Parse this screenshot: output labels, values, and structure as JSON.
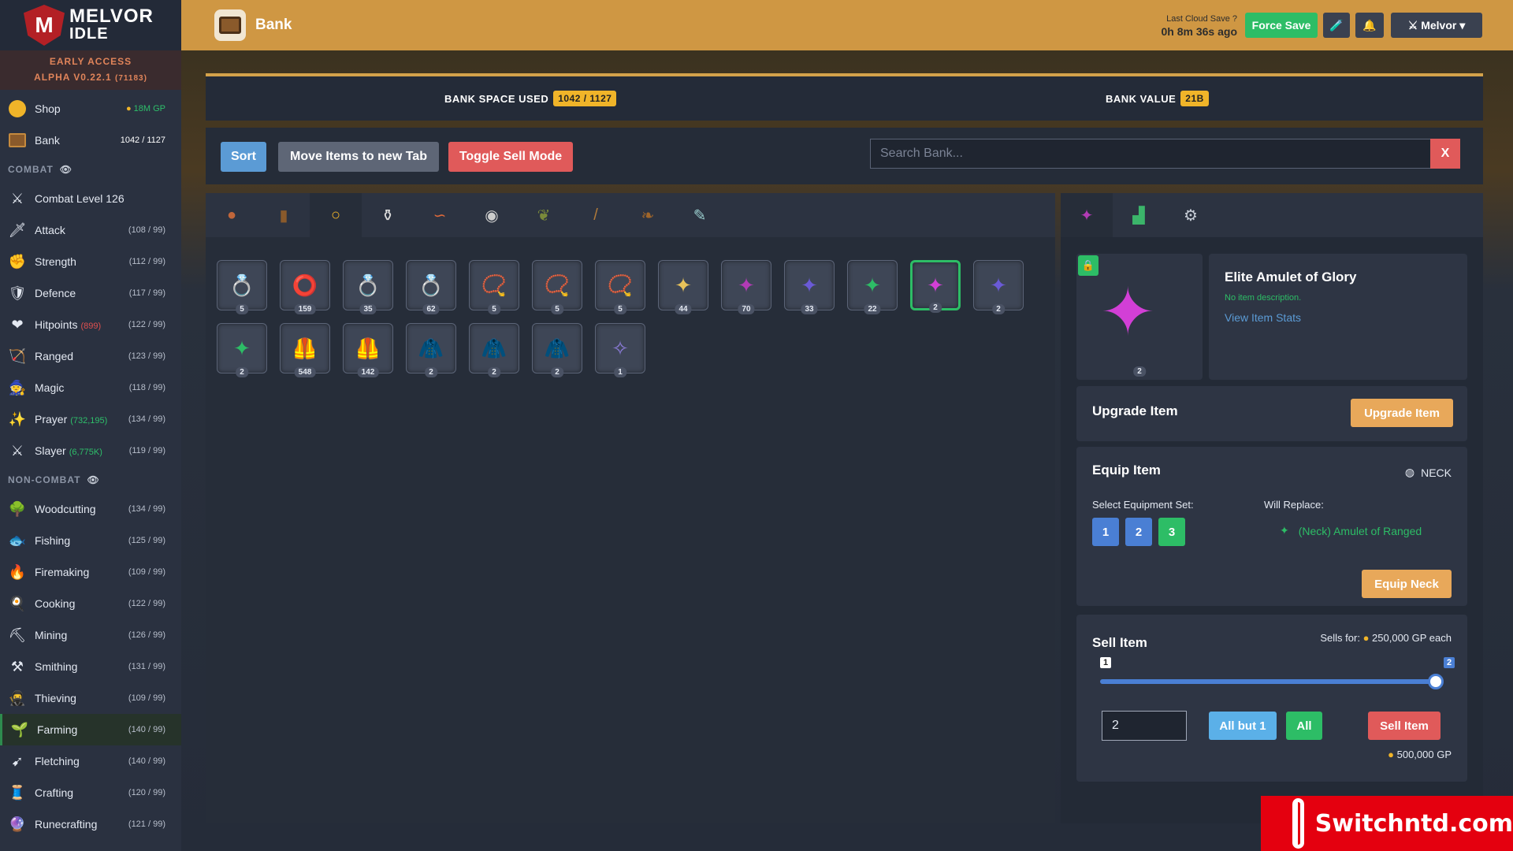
{
  "sidebar": {
    "logo_line1": "MELVOR",
    "logo_line2": "IDLE",
    "early_access": "EARLY ACCESS",
    "version": "ALPHA V0.22.1",
    "build": "(71183)",
    "shop": {
      "label": "Shop",
      "value": "18M GP"
    },
    "bank": {
      "label": "Bank",
      "value": "1042 / 1127"
    },
    "combat_header": "COMBAT",
    "combat_level": "Combat Level 126",
    "combat_skills": [
      {
        "name": "Attack",
        "sub": "",
        "lv": "(108 / 99)",
        "icon": "sword-icon",
        "glyph": "🗡"
      },
      {
        "name": "Strength",
        "sub": "",
        "lv": "(112 / 99)",
        "icon": "fist-icon",
        "glyph": "✊"
      },
      {
        "name": "Defence",
        "sub": "",
        "lv": "(117 / 99)",
        "icon": "shield-icon",
        "glyph": "🛡"
      },
      {
        "name": "Hitpoints",
        "sub": "(899)",
        "lv": "(122 / 99)",
        "icon": "heart-icon",
        "glyph": "❤"
      },
      {
        "name": "Ranged",
        "sub": "",
        "lv": "(123 / 99)",
        "icon": "bow-icon",
        "glyph": "🏹"
      },
      {
        "name": "Magic",
        "sub": "",
        "lv": "(118 / 99)",
        "icon": "wizard-hat-icon",
        "glyph": "🧙"
      },
      {
        "name": "Prayer",
        "sub": "(732,195)",
        "lv": "(134 / 99)",
        "icon": "prayer-icon",
        "glyph": "✨"
      },
      {
        "name": "Slayer",
        "sub": "(6,775K)",
        "lv": "(119 / 99)",
        "icon": "slayer-icon",
        "glyph": "⚔"
      }
    ],
    "noncombat_header": "NON-COMBAT",
    "noncombat_skills": [
      {
        "name": "Woodcutting",
        "lv": "(134 / 99)",
        "icon": "tree-icon",
        "glyph": "🌳"
      },
      {
        "name": "Fishing",
        "lv": "(125 / 99)",
        "icon": "fish-icon",
        "glyph": "🐟"
      },
      {
        "name": "Firemaking",
        "lv": "(109 / 99)",
        "icon": "fire-icon",
        "glyph": "🔥"
      },
      {
        "name": "Cooking",
        "lv": "(122 / 99)",
        "icon": "chef-hat-icon",
        "glyph": "🍳"
      },
      {
        "name": "Mining",
        "lv": "(126 / 99)",
        "icon": "pickaxe-icon",
        "glyph": "⛏"
      },
      {
        "name": "Smithing",
        "lv": "(131 / 99)",
        "icon": "anvil-icon",
        "glyph": "⚒"
      },
      {
        "name": "Thieving",
        "lv": "(109 / 99)",
        "icon": "thief-icon",
        "glyph": "🥷"
      },
      {
        "name": "Farming",
        "lv": "(140 / 99)",
        "icon": "sprout-icon",
        "glyph": "🌱"
      },
      {
        "name": "Fletching",
        "lv": "(140 / 99)",
        "icon": "arrow-icon",
        "glyph": "➹"
      },
      {
        "name": "Crafting",
        "lv": "(120 / 99)",
        "icon": "crafting-icon",
        "glyph": "🧵"
      },
      {
        "name": "Runecrafting",
        "lv": "(121 / 99)",
        "icon": "rune-icon",
        "glyph": "🔮"
      }
    ]
  },
  "header": {
    "title": "Bank",
    "cloud_label": "Last Cloud Save",
    "cloud_time": "0h 8m 36s ago",
    "force_save": "Force Save",
    "user": "Melvor"
  },
  "infobar": {
    "space_label": "BANK SPACE USED",
    "space_value": "1042 / 1127",
    "value_label": "BANK VALUE",
    "value_value": "21B"
  },
  "toolbar": {
    "sort": "Sort",
    "move": "Move Items to new Tab",
    "toggle_sell": "Toggle Sell Mode",
    "search_placeholder": "Search Bank...",
    "clear": "X"
  },
  "items": [
    {
      "count": "5",
      "glyph": "💍"
    },
    {
      "count": "159",
      "glyph": "⭕"
    },
    {
      "count": "35",
      "glyph": "💍"
    },
    {
      "count": "62",
      "glyph": "💍"
    },
    {
      "count": "5",
      "glyph": "📿"
    },
    {
      "count": "5",
      "glyph": "📿"
    },
    {
      "count": "5",
      "glyph": "📿"
    },
    {
      "count": "44",
      "glyph": "✦"
    },
    {
      "count": "70",
      "glyph": "✦"
    },
    {
      "count": "33",
      "glyph": "✦"
    },
    {
      "count": "22",
      "glyph": "✦"
    },
    {
      "count": "2",
      "glyph": "✦"
    },
    {
      "count": "2",
      "glyph": "✦"
    },
    {
      "count": "2",
      "glyph": "✦"
    },
    {
      "count": "548",
      "glyph": "🦺"
    },
    {
      "count": "142",
      "glyph": "🦺"
    },
    {
      "count": "2",
      "glyph": "🧥"
    },
    {
      "count": "2",
      "glyph": "🧥"
    },
    {
      "count": "2",
      "glyph": "🧥"
    },
    {
      "count": "1",
      "glyph": "✧"
    }
  ],
  "detail": {
    "name": "Elite Amulet of Glory",
    "description": "No item description.",
    "view_stats": "View Item Stats",
    "count": "2",
    "upgrade_title": "Upgrade Item",
    "upgrade_btn": "Upgrade Item",
    "equip_title": "Equip Item",
    "slot": "NECK",
    "select_set": "Select Equipment Set:",
    "sets": [
      "1",
      "2",
      "3"
    ],
    "will_replace": "Will Replace:",
    "replace_item": "(Neck) Amulet of Ranged",
    "equip_btn": "Equip Neck",
    "sell_title": "Sell Item",
    "sells_for_label": "Sells for:",
    "sells_for": "250,000 GP each",
    "slider_min": "1",
    "slider_max": "2",
    "slider_value": 2,
    "qty": "2",
    "all_but_1": "All but 1",
    "all": "All",
    "sell_btn": "Sell Item",
    "total": "500,000 GP"
  },
  "watermark": "Switchntd.com",
  "colors": {
    "accent": "#cf9743",
    "green": "#2dbd66",
    "blue": "#5b9bd5",
    "red": "#e05a5a",
    "orange": "#f0b429"
  }
}
